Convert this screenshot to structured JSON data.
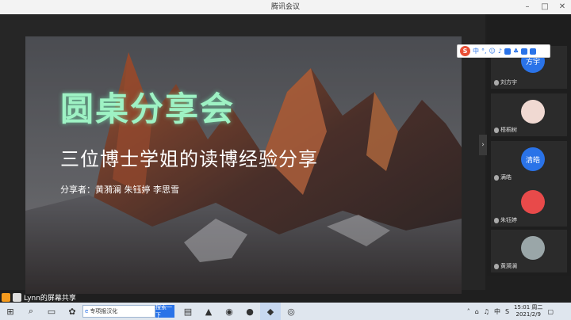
{
  "window": {
    "title": "腾讯会议"
  },
  "slide": {
    "title": "圆桌分享会",
    "subtitle": "三位博士学姐的读博经验分享",
    "speakers": "分享者：黄漪澜  朱钰婷  李思雪"
  },
  "participants": [
    {
      "name": "刘方宇",
      "avatar_text": "方宇",
      "avatar_color": "#2a73e8"
    },
    {
      "name": "梧桐树",
      "avatar_text": "",
      "avatar_color": "#f0d9d2"
    },
    {
      "name": "满皓",
      "avatar_text": "清皓",
      "avatar_color": "#2a73e8"
    },
    {
      "name": "朱钰婷",
      "avatar_text": "",
      "avatar_color": "#e84a4a"
    },
    {
      "name": "黄漪澜",
      "avatar_text": "",
      "avatar_color": "#9aa6a8"
    }
  ],
  "ime": {
    "lang": "中"
  },
  "share": {
    "label": "Lynn的屏幕共享"
  },
  "taskbar": {
    "search_placeholder": "专项报汉化",
    "search_button": "搜索一下"
  },
  "tray": {
    "lang": "中",
    "time": "15:01 周二",
    "date": "2021/2/9"
  }
}
